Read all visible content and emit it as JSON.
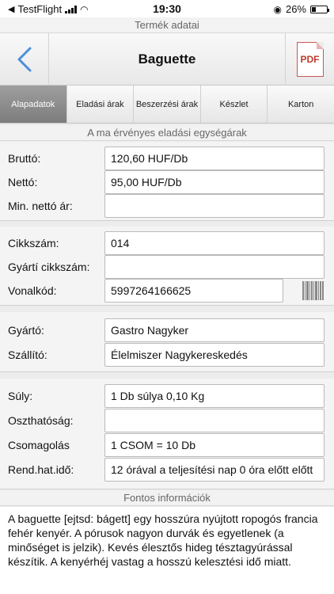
{
  "status": {
    "carrier": "TestFlight",
    "time": "19:30",
    "battery": "26%",
    "battery_level": 0.26
  },
  "screen_title": "Termék adatai",
  "nav": {
    "title": "Baguette",
    "pdf_label": "PDF"
  },
  "tabs": [
    {
      "label": "Alapadatok",
      "active": true
    },
    {
      "label": "Eladási árak"
    },
    {
      "label": "Beszerzési árak"
    },
    {
      "label": "Készlet"
    },
    {
      "label": "Karton"
    }
  ],
  "price_section_label": "A ma érvényes eladási egységárak",
  "prices": {
    "brutto": {
      "label": "Bruttó:",
      "value": "120,60 HUF/Db"
    },
    "netto": {
      "label": "Nettó:",
      "value": "95,00 HUF/Db"
    },
    "min_netto": {
      "label": "Min. nettó ár:",
      "value": ""
    }
  },
  "codes": {
    "cikkszam": {
      "label": "Cikkszám:",
      "value": "014"
    },
    "gyarti": {
      "label": "Gyártí cikkszám:",
      "value": ""
    },
    "vonalkod": {
      "label": "Vonalkód:",
      "value": "5997264166625"
    }
  },
  "supplier": {
    "gyarto": {
      "label": "Gyártó:",
      "value": "Gastro Nagyker"
    },
    "szallito": {
      "label": "Szállító:",
      "value": "Élelmiszer Nagykereskedés"
    }
  },
  "details": {
    "suly": {
      "label": "Súly:",
      "value": "1 Db súlya 0,10 Kg"
    },
    "oszthatosag": {
      "label": "Oszthatóság:",
      "value": ""
    },
    "csomagolas": {
      "label": "Csomagolás",
      "value": "1 CSOM = 10 Db"
    },
    "rend": {
      "label": "Rend.hat.idő:",
      "value": "12 órával a teljesítési nap 0 óra előtt előtt"
    }
  },
  "info_section_label": "Fontos információk",
  "info_text": "A baguette [ejtsd: bágett] egy hosszúra nyújtott ropogós francia fehér kenyér. A pórusok nagyon durvák és egyetlenek (a minőséget is jelzik). Kevés élesztős hideg tésztagyúrással készítik. A kenyérhéj vastag a hosszú kelesztési idő miatt."
}
